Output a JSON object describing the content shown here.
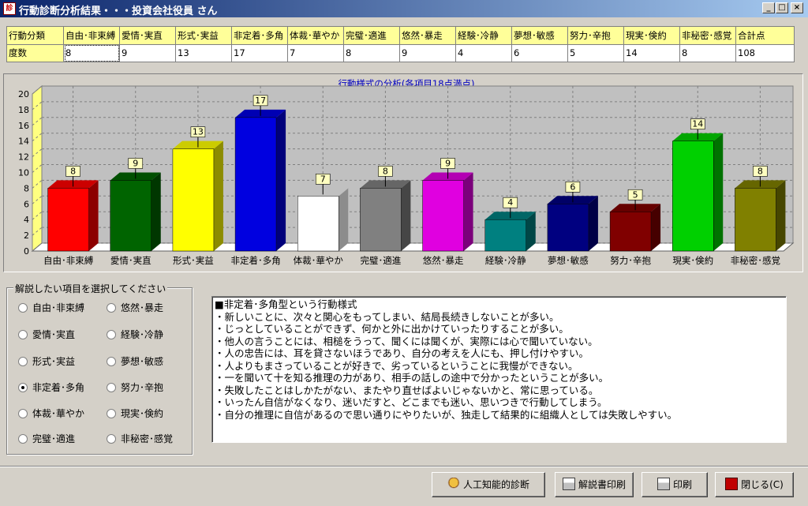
{
  "window": {
    "title": "行動診断分析結果・・・投資会社役員 さん",
    "icon_label": "診"
  },
  "window_buttons": {
    "minimize": "_",
    "maximize": "□",
    "close": "×"
  },
  "table": {
    "header": [
      "行動分類",
      "自由･非束縛",
      "愛情･実直",
      "形式･実益",
      "非定着･多角",
      "体裁･華やか",
      "完璧･適進",
      "悠然･暴走",
      "経験･冷静",
      "夢想･敏感",
      "努力･辛抱",
      "現実･倹約",
      "非秘密･感覚",
      "合計点"
    ],
    "row": [
      "度数",
      "8",
      "9",
      "13",
      "17",
      "7",
      "8",
      "9",
      "4",
      "6",
      "5",
      "14",
      "8",
      "108"
    ]
  },
  "chart_data": {
    "type": "bar",
    "title": "行動様式の分析(各項目18点満点)",
    "categories": [
      "自由･非束縛",
      "愛情･実直",
      "形式･実益",
      "非定着･多角",
      "体裁･華やか",
      "完璧･適進",
      "悠然･暴走",
      "経験･冷静",
      "夢想･敏感",
      "努力･辛抱",
      "現実･倹約",
      "非秘密･感覚"
    ],
    "values": [
      8,
      9,
      13,
      17,
      7,
      8,
      9,
      4,
      6,
      5,
      14,
      8
    ],
    "colors": [
      "#ff0000",
      "#006400",
      "#ffff00",
      "#0000e0",
      "#ffffff",
      "#808080",
      "#e000e0",
      "#008080",
      "#000080",
      "#800000",
      "#00d000",
      "#808000"
    ],
    "ylim": [
      0,
      20
    ],
    "yticks": [
      "0",
      "2",
      "4",
      "6",
      "8",
      "10",
      "12",
      "14",
      "16",
      "18",
      "20"
    ],
    "grid": true,
    "legend": "none"
  },
  "selector": {
    "legend": "解説したい項目を選択してください",
    "options": [
      "自由･非束縛",
      "愛情･実直",
      "形式･実益",
      "非定着･多角",
      "体裁･華やか",
      "完璧･適進",
      "悠然･暴走",
      "経験･冷静",
      "夢想･敏感",
      "努力･辛抱",
      "現実･倹約",
      "非秘密･感覚"
    ],
    "selected": "非定着･多角"
  },
  "description": {
    "lines": [
      "■非定着･多角型という行動様式",
      "・新しいことに、次々と関心をもってしまい、結局長続きしないことが多い。",
      "・じっとしていることができず、何かと外に出かけていったりすることが多い。",
      "・他人の言うことには、相槌をうって、聞くには聞くが、実際には心で聞いていない。",
      "・人の忠告には、耳を貸さないほうであり、自分の考えを人にも、押し付けやすい。",
      "・人よりもまさっていることが好きで、劣っているということに我慢ができない。",
      "・一を聞いて十を知る推理の力があり、相手の話しの途中で分かったということが多い。",
      "・失敗したことはしかたがない、またやり直せばよいじゃないかと、常に思っている。",
      "・いったん自信がなくなり、迷いだすと、どこまでも迷い、思いつきで行動してしまう。",
      "・自分の推理に自信があるので思い通りにやりたいが、独走して結果的に組織人としては失敗しやすい。"
    ]
  },
  "buttons": {
    "ai_diagnosis": "人工知能的診断",
    "print_manual": "解説書印刷",
    "print": "印刷",
    "close": "閉じる(C)"
  }
}
